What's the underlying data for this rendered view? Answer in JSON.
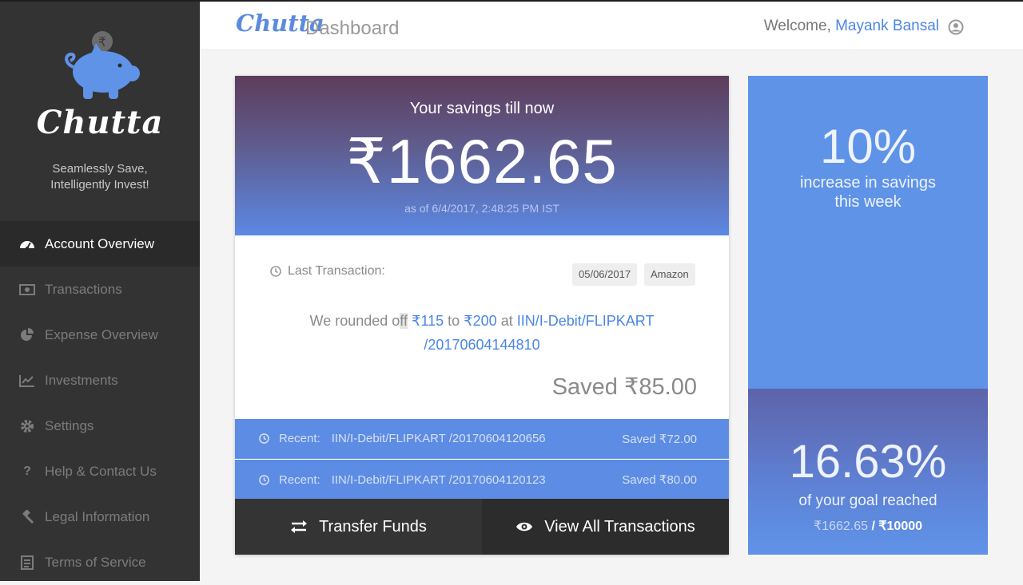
{
  "brand": {
    "name": "Chutta",
    "tagline_line1": "Seamlessly Save,",
    "tagline_line2": "Intelligently Invest!"
  },
  "sidebar": {
    "items": [
      {
        "label": "Account Overview",
        "icon": "dashboard-icon",
        "active": true
      },
      {
        "label": "Transactions",
        "icon": "money-icon"
      },
      {
        "label": "Expense Overview",
        "icon": "pie-chart-icon"
      },
      {
        "label": "Investments",
        "icon": "line-chart-icon"
      },
      {
        "label": "Settings",
        "icon": "gear-icon"
      },
      {
        "label": "Help & Contact Us",
        "icon": "question-icon"
      },
      {
        "label": "Legal Information",
        "icon": "gavel-icon"
      },
      {
        "label": "Terms of Service",
        "icon": "document-icon"
      }
    ]
  },
  "header": {
    "logo": "Chutta",
    "title": "Dashboard",
    "welcome": "Welcome,",
    "user_name": "Mayank Bansal"
  },
  "savings": {
    "label": "Your savings till now",
    "amount": "₹1662.65",
    "as_of": "as of 6/4/2017, 2:48:25 PM IST"
  },
  "last_transaction": {
    "label": "Last Transaction:",
    "date": "05/06/2017",
    "merchant": "Amazon",
    "text_prefix": "We rounded o",
    "text_hl": "ff",
    "amount_from": "₹115",
    "text_to": "to",
    "amount_to": "₹200",
    "text_at": "at",
    "ref_line1": "IIN/I-Debit/FLIPKART",
    "ref_line2": "/20170604144810",
    "saved": "Saved ₹85.00"
  },
  "recent": [
    {
      "label": "Recent:",
      "ref": "IIN/I-Debit/FLIPKART /20170604120656",
      "saved": "Saved ₹72.00"
    },
    {
      "label": "Recent:",
      "ref": "IIN/I-Debit/FLIPKART /20170604120123",
      "saved": "Saved ₹80.00"
    }
  ],
  "actions": {
    "transfer": "Transfer Funds",
    "view_all": "View All Transactions"
  },
  "stats": {
    "weekly_pct": "10%",
    "weekly_line1": "increase in savings",
    "weekly_line2": "this week",
    "goal_pct": "16.63%",
    "goal_desc": "of your goal reached",
    "goal_current": "₹1662.65",
    "goal_sep": " / ",
    "goal_target": "₹10000"
  },
  "colors": {
    "accent": "#4a86e8",
    "sidebar_bg": "#333333",
    "stat_blue": "#5f93e8"
  }
}
